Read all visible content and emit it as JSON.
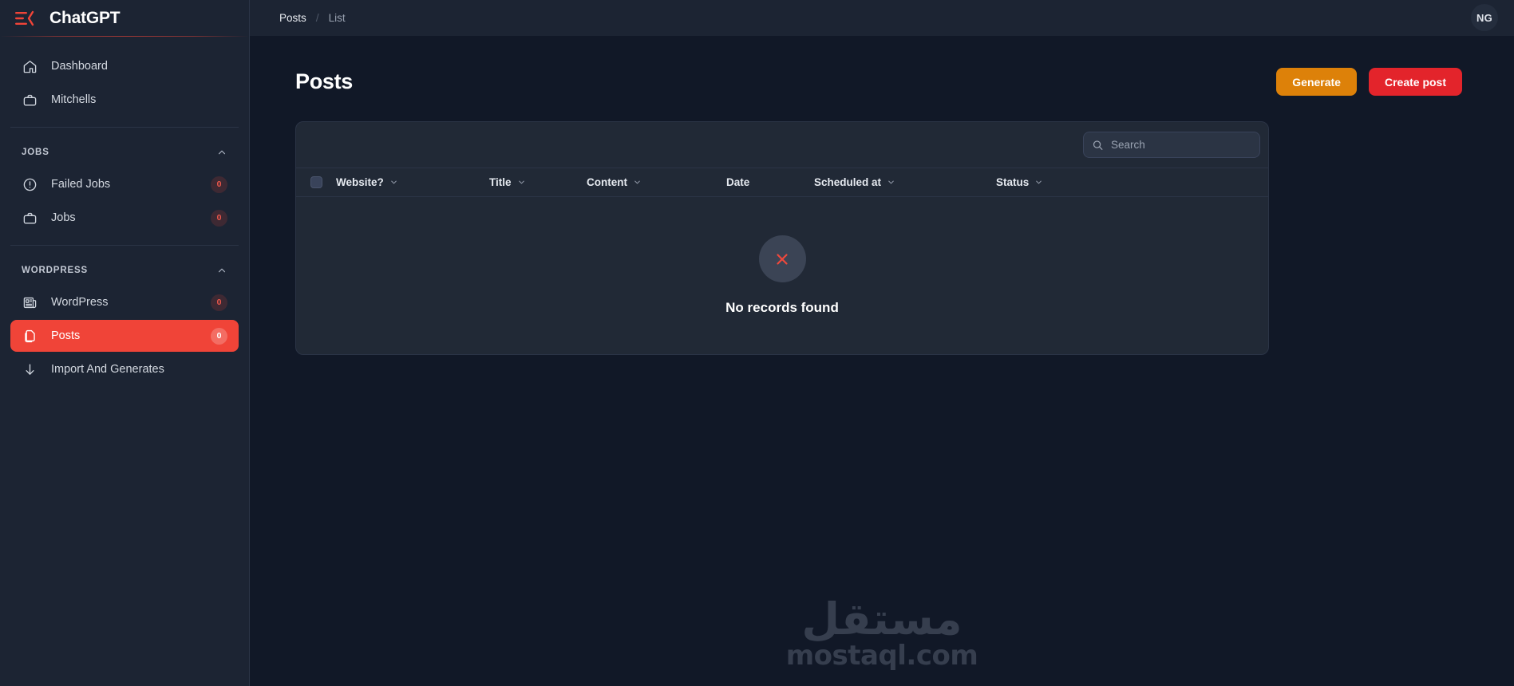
{
  "brand": {
    "title": "ChatGPT",
    "logo_icon": "menu-chevron-logo-icon",
    "accent_color": "#f04438"
  },
  "sidebar": {
    "primary_items": [
      {
        "label": "Dashboard",
        "icon": "home-icon"
      },
      {
        "label": "Mitchells",
        "icon": "briefcase-icon"
      }
    ],
    "sections": [
      {
        "title": "JOBS",
        "collapse_icon": "chevron-up-icon",
        "items": [
          {
            "label": "Failed Jobs",
            "icon": "alert-circle-icon",
            "badge": "0"
          },
          {
            "label": "Jobs",
            "icon": "briefcase-icon",
            "badge": "0"
          }
        ]
      },
      {
        "title": "WORDPRESS",
        "collapse_icon": "chevron-up-icon",
        "items": [
          {
            "label": "WordPress",
            "icon": "newspaper-icon",
            "badge": "0"
          },
          {
            "label": "Posts",
            "icon": "documents-icon",
            "badge": "0",
            "active": true
          },
          {
            "label": "Import And Generates",
            "icon": "arrow-down-icon"
          }
        ]
      }
    ]
  },
  "topbar": {
    "breadcrumb": {
      "current": "Posts",
      "separator": "/",
      "sub": "List"
    },
    "avatar": {
      "initials": "NG"
    }
  },
  "page": {
    "title": "Posts",
    "actions": {
      "generate_label": "Generate",
      "generate_color": "#dd8109",
      "create_label": "Create post",
      "create_color": "#e3242b"
    }
  },
  "table": {
    "search": {
      "placeholder": "Search",
      "value": "",
      "icon": "search-icon"
    },
    "columns": [
      {
        "label": "Website?",
        "sortable": true
      },
      {
        "label": "Title",
        "sortable": true
      },
      {
        "label": "Content",
        "sortable": true
      },
      {
        "label": "Date",
        "sortable": false
      },
      {
        "label": "Scheduled at",
        "sortable": true
      },
      {
        "label": "Status",
        "sortable": true
      }
    ],
    "rows": [],
    "empty_state": {
      "icon": "x-circle-icon",
      "message": "No records found"
    }
  },
  "watermark": {
    "arabic": "مستقل",
    "latin": "mostaql.com"
  }
}
